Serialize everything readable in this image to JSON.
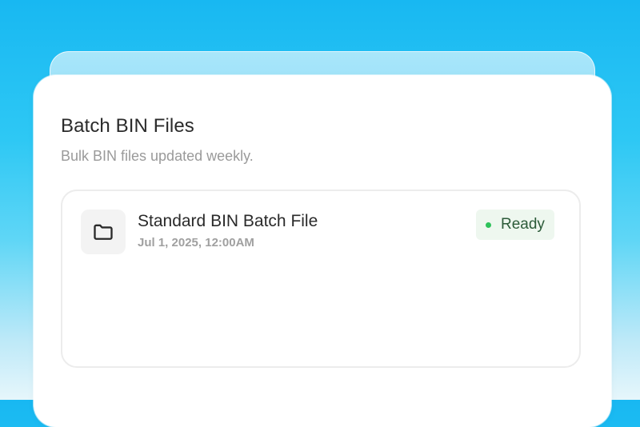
{
  "card": {
    "title": "Batch BIN Files",
    "subtitle": "Bulk BIN files updated weekly."
  },
  "file": {
    "name": "Standard BIN Batch File",
    "date": "Jul 1, 2025, 12:00AM",
    "icon": "folder-icon",
    "status": {
      "label": "Ready",
      "dot_color": "#2ec25a",
      "background": "#eef7ef",
      "text_color": "#2c5b39"
    }
  },
  "colors": {
    "background_top": "#18b8f2",
    "background_bottom": "#e6f6fb",
    "card": "#ffffff"
  }
}
